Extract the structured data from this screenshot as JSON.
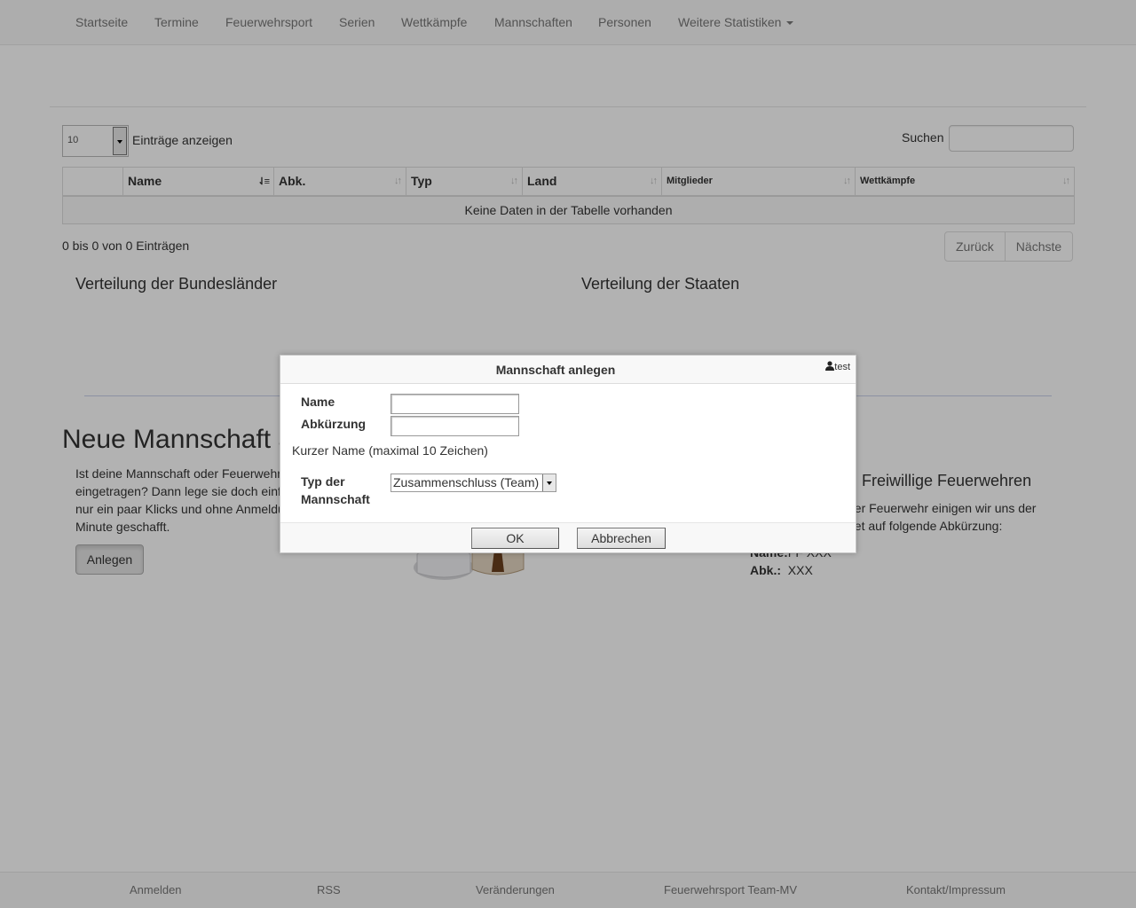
{
  "nav": {
    "items": [
      {
        "label": "Startseite"
      },
      {
        "label": "Termine"
      },
      {
        "label": "Feuerwehrsport"
      },
      {
        "label": "Serien"
      },
      {
        "label": "Wettkämpfe"
      },
      {
        "label": "Mannschaften"
      },
      {
        "label": "Personen"
      }
    ],
    "dropdown_label": "Weitere Statistiken"
  },
  "table": {
    "length_value": "10",
    "length_label": "Einträge anzeigen",
    "search_label": "Suchen",
    "columns": [
      {
        "label": ""
      },
      {
        "label": "Name"
      },
      {
        "label": "Abk."
      },
      {
        "label": "Typ"
      },
      {
        "label": "Land"
      },
      {
        "label": "Mitglieder"
      },
      {
        "label": "Wettkämpfe"
      }
    ],
    "empty_text": "Keine Daten in der Tabelle vorhanden",
    "info": "0 bis 0 von 0 Einträgen",
    "prev_label": "Zurück",
    "next_label": "Nächste"
  },
  "charts": {
    "bundeslaender_title": "Verteilung der Bundesländer",
    "staaten_title": "Verteilung der Staaten"
  },
  "new_team": {
    "heading": "Neue Mannschaft a",
    "text_lines": [
      "Ist deine Mannschaft oder Feuerwehr",
      "eingetragen? Dann lege sie doch einf",
      "nur ein paar Klicks und ohne Anmeldu",
      "Minute geschafft."
    ],
    "button_label": "Anlegen"
  },
  "ff": {
    "heading": "Freiwillige Feuerwehren",
    "text_lines": [
      "ner Feuerwehr einigen wir uns der",
      "det auf folgende Abkürzung:"
    ],
    "name_label": "Name:",
    "name_value": "FF XXX",
    "abk_label": "Abk.:",
    "abk_value": "XXX"
  },
  "dialog": {
    "title": "Mannschaft anlegen",
    "close_label": "test",
    "name_label": "Name",
    "abk_label": "Abkürzung",
    "hint": "Kurzer Name (maximal 10 Zeichen)",
    "type_label_1": "Typ der",
    "type_label_2": "Mannschaft",
    "type_value": "Zusammenschluss (Team)",
    "ok_label": "OK",
    "cancel_label": "Abbrechen"
  },
  "footer": {
    "links": [
      {
        "label": "Anmelden"
      },
      {
        "label": "RSS"
      },
      {
        "label": "Veränderungen"
      },
      {
        "label": "Feuerwehrsport Team-MV"
      },
      {
        "label": "Kontakt/Impressum"
      }
    ]
  }
}
